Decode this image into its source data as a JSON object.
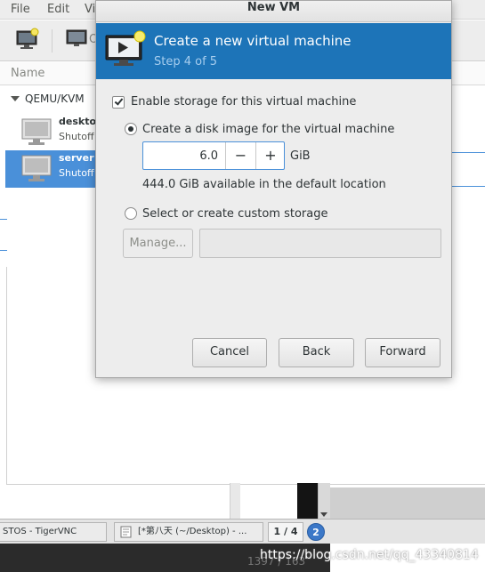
{
  "background_window": {
    "menu": [
      "File",
      "Edit",
      "Vi"
    ],
    "toolbar_partial_label": "O",
    "column_header": "Name",
    "group": "QEMU/KVM",
    "vms": [
      {
        "name": "deskto",
        "status": "Shutoff",
        "selected": false
      },
      {
        "name": "server",
        "status": "Shutoff",
        "selected": true
      }
    ]
  },
  "dialog": {
    "title": "New VM",
    "banner": {
      "title": "Create a new virtual machine",
      "step": "Step 4 of 5",
      "icon": "monitor-star-icon",
      "color": "#1d74b8"
    },
    "enable_storage": {
      "label": "Enable storage for this virtual machine",
      "checked": true
    },
    "disk_image_option": {
      "label": "Create a disk image for the virtual machine",
      "selected": true
    },
    "disk_size": {
      "value": "6.0",
      "unit": "GiB",
      "minus": "−",
      "plus": "+"
    },
    "available_text": "444.0 GiB available in the default location",
    "custom_storage_option": {
      "label": "Select or create custom storage",
      "selected": false
    },
    "manage_button": "Manage...",
    "custom_path_value": "",
    "buttons": {
      "cancel": "Cancel",
      "back": "Back",
      "forward": "Forward"
    }
  },
  "taskbar": {
    "tasks": [
      "STOS - TigerVNC",
      "[*第八天 (~/Desktop) - ..."
    ],
    "pager": "1 / 4",
    "notification_count": "2"
  },
  "overlay": {
    "coordinates": "1397 / 163",
    "watermark": "https://blog.csdn.net/qq_43340814"
  }
}
